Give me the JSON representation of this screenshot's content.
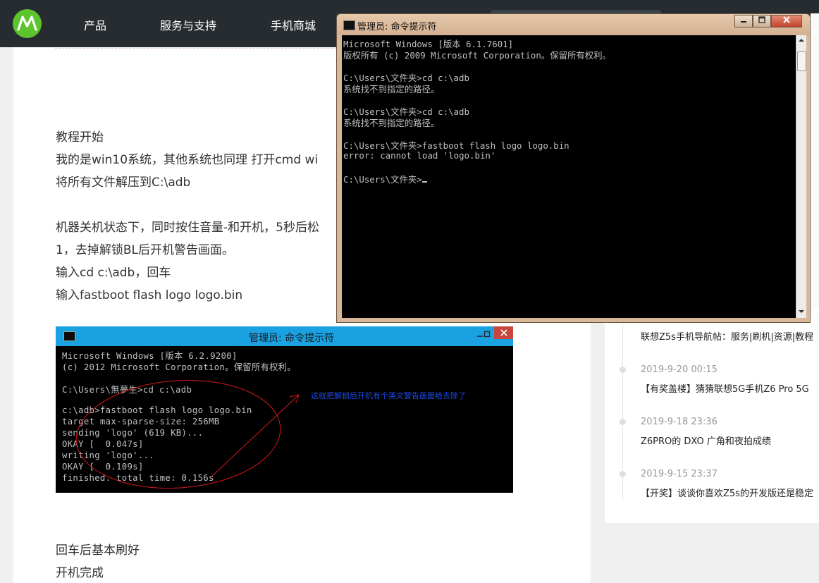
{
  "nav": {
    "items": [
      "产品",
      "服务与支持",
      "手机商城"
    ]
  },
  "article": {
    "paragraphs": [
      "教程开始",
      "我的是win10系统，其他系统也同理 打开cmd   wi",
      "将所有文件解压到C:\\adb",
      "机器关机状态下，同时按住音量-和开机，5秒后松",
      "1，去掉解锁BL后开机警告画面。",
      "输入cd c:\\adb，回车",
      "输入fastboot flash logo logo.bin",
      "回车后基本刷好",
      "开机完成"
    ],
    "screenshot": {
      "title": "管理员: 命令提示符",
      "lines": [
        "Microsoft Windows [版本 6.2.9200]",
        "(c) 2012 Microsoft Corporation。保留所有权利。",
        "",
        "C:\\Users\\無夢生>cd c:\\adb",
        "",
        "c:\\adb>fastboot flash logo logo.bin",
        "target max-sparse-size: 256MB",
        "sending 'logo' (619 KB)...",
        "OKAY [  0.047s]",
        "writing 'logo'...",
        "OKAY [  0.109s]",
        "finished. total time: 0.156s"
      ],
      "annotation": "这就把解锁后开机有个英文警告画面给去除了"
    }
  },
  "sidebar": {
    "posts": [
      {
        "date": "",
        "title": "联想Z5s手机导航帖：服务|刷机|资源|教程"
      },
      {
        "date": "2019-9-20 00:15",
        "title": "【有奖盖楼】猜猜联想5G手机Z6 Pro 5G"
      },
      {
        "date": "2019-9-18 23:36",
        "title": "Z6PRO的 DXO 广角和夜拍成绩"
      },
      {
        "date": "2019-9-15 23:37",
        "title": "【开奖】谈谈你喜欢Z5s的开发版还是稳定"
      }
    ]
  },
  "cmd_window": {
    "title": "管理员: 命令提示符",
    "lines": [
      "Microsoft Windows [版本 6.1.7601]",
      "版权所有 (c) 2009 Microsoft Corporation。保留所有权利。",
      "",
      "C:\\Users\\文件夹>cd c:\\adb",
      "系统找不到指定的路径。",
      "",
      "C:\\Users\\文件夹>cd c:\\adb",
      "系统找不到指定的路径。",
      "",
      "C:\\Users\\文件夹>fastboot flash logo logo.bin",
      "error: cannot load 'logo.bin'",
      "",
      "C:\\Users\\文件夹>"
    ]
  },
  "colors": {
    "nav_bg": "#272c30",
    "logo_green": "#5cc42c",
    "annotation_red": "#d4181a",
    "annotation_blue": "#1e4be8"
  }
}
